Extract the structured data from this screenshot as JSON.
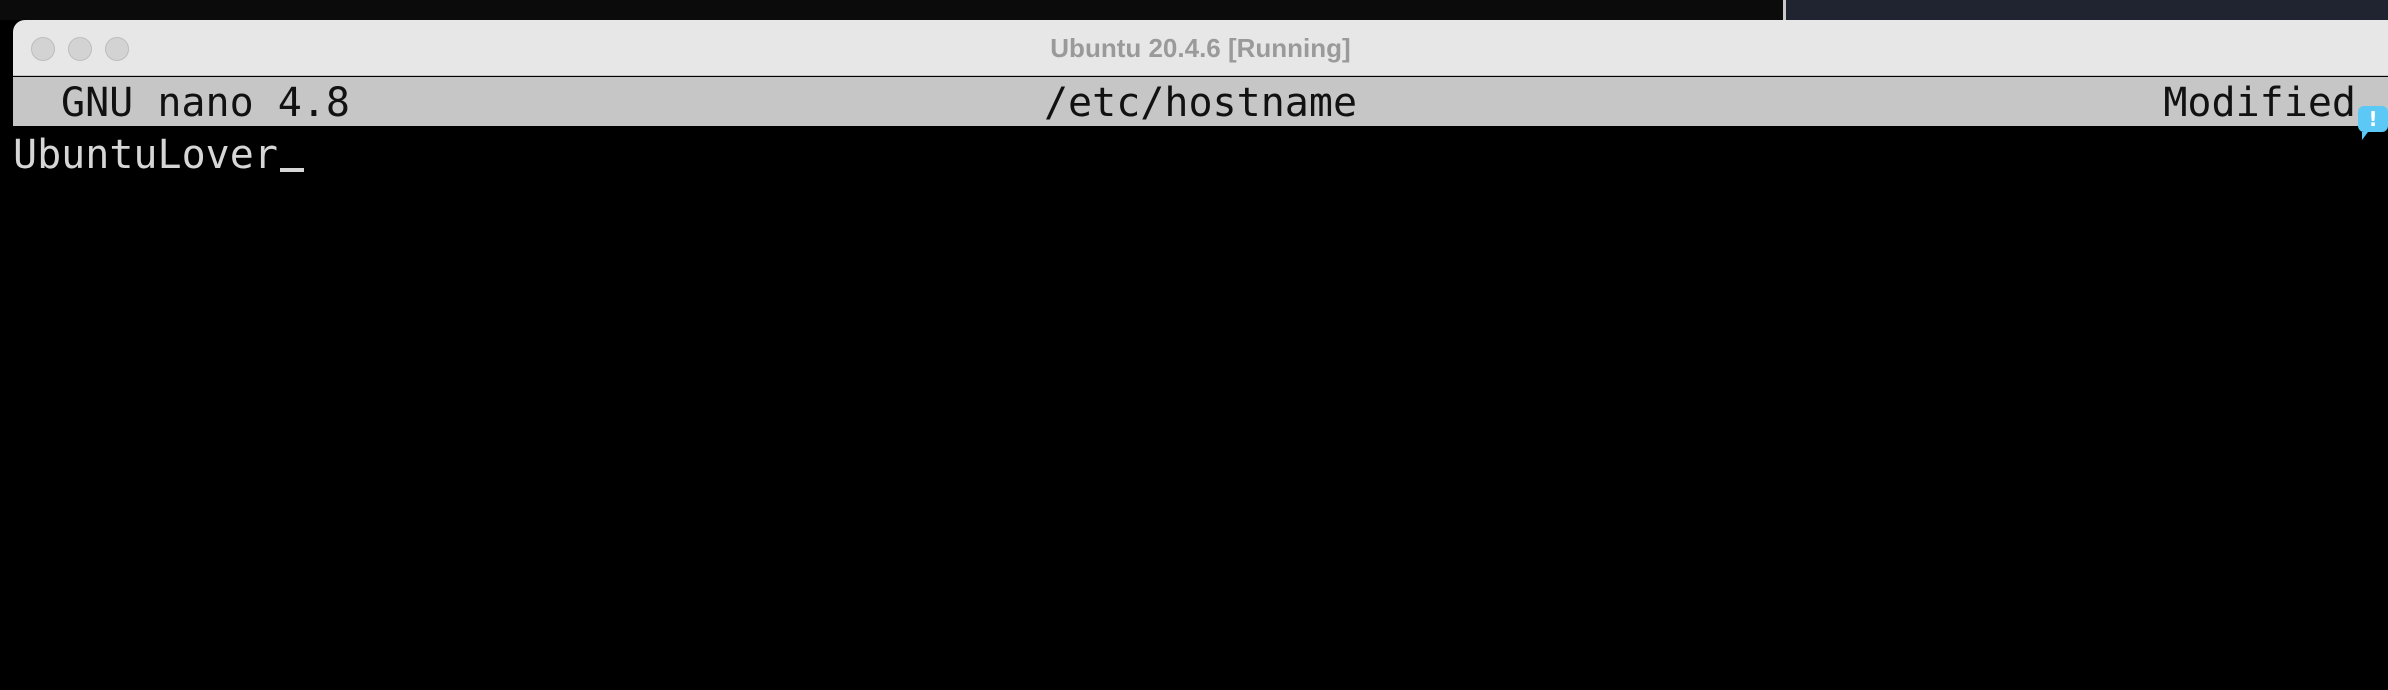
{
  "window": {
    "title": "Ubuntu 20.4.6 [Running]"
  },
  "nano": {
    "version": "GNU nano 4.8",
    "filename": "/etc/hostname",
    "status": "Modified",
    "content": "UbuntuLover"
  },
  "notification": {
    "icon": "notification-speech-bubble-icon",
    "glyph": "!",
    "color": "#5bc8f5"
  },
  "colors": {
    "title_bar": "#e7e7e7",
    "nano_bar": "#c6c6c6",
    "terminal_bg": "#000000",
    "terminal_text": "#d6d6d6"
  }
}
